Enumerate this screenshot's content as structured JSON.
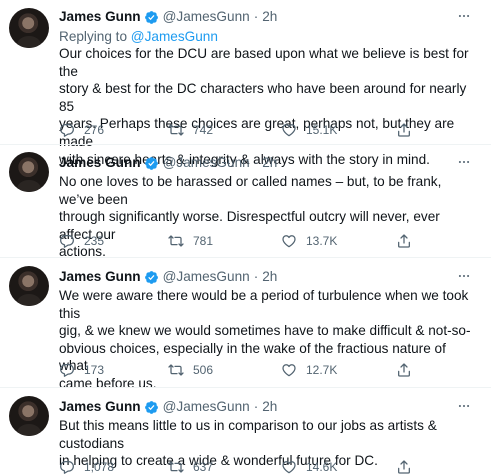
{
  "colors": {
    "accent": "#1d9bf0",
    "muted": "#536471",
    "text": "#0f1419",
    "divider": "#eff3f4"
  },
  "tweets": [
    {
      "name": "James Gunn",
      "handle": "@JamesGunn",
      "dot": "·",
      "time": "2h",
      "replying_prefix": "Replying to",
      "replying_to": "@JamesGunn",
      "text": "Our choices for the DCU are based upon what we believe is best for the\nstory & best for the DC characters who have been around for nearly 85\nyears. Perhaps these choices are great, perhaps not, but they are made\nwith sincere hearts & integrity & always with the story in mind.",
      "replies": "276",
      "retweets": "742",
      "likes": "15.1K"
    },
    {
      "name": "James Gunn",
      "handle": "@JamesGunn",
      "dot": "·",
      "time": "2h",
      "text": "No one loves to be harassed or called names – but, to be frank, we’ve been\nthrough significantly worse. Disrespectful outcry will never, ever affect our\nactions.",
      "replies": "235",
      "retweets": "781",
      "likes": "13.7K"
    },
    {
      "name": "James Gunn",
      "handle": "@JamesGunn",
      "dot": "·",
      "time": "2h",
      "text": "We were aware there would be a period of turbulence when we took this\ngig, & we knew we would sometimes have to make difficult & not-so-\nobvious choices, especially in the wake of the fractious nature of what\ncame before us.",
      "replies": "173",
      "retweets": "506",
      "likes": "12.7K"
    },
    {
      "name": "James Gunn",
      "handle": "@JamesGunn",
      "dot": "·",
      "time": "2h",
      "text": "But this means little to us in comparison to our jobs as artists & custodians\nin helping to create a wide & wonderful future for DC.",
      "replies": "1,078",
      "retweets": "637",
      "likes": "14.6K"
    }
  ]
}
